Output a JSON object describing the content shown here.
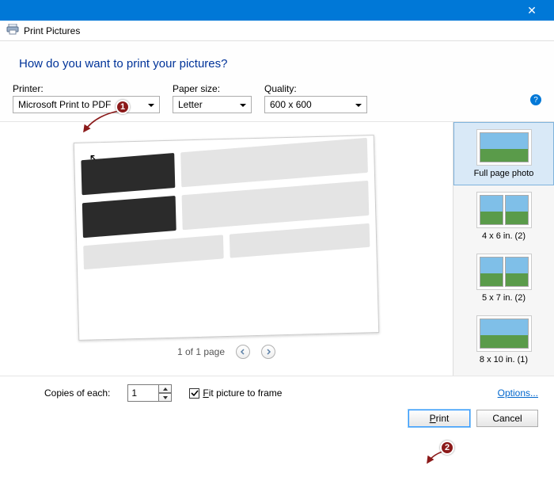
{
  "titlebar": {
    "close": "✕"
  },
  "subtitle": {
    "text": "Print Pictures"
  },
  "heading": {
    "question": "How do you want to print your pictures?"
  },
  "controls": {
    "printer": {
      "label": "Printer:",
      "value": "Microsoft Print to PDF",
      "width": 186
    },
    "paper": {
      "label": "Paper size:",
      "value": "Letter",
      "width": 100
    },
    "quality": {
      "label": "Quality:",
      "value": "600 x 600",
      "width": 130
    },
    "help": "?"
  },
  "preview": {
    "page_status": "1 of 1 page"
  },
  "layouts": [
    {
      "label": "Full page photo",
      "count": 1,
      "selected": true
    },
    {
      "label": "4 x 6 in. (2)",
      "count": 2,
      "selected": false
    },
    {
      "label": "5 x 7 in. (2)",
      "count": 2,
      "selected": false
    },
    {
      "label": "8 x 10 in. (1)",
      "count": 1,
      "selected": false
    }
  ],
  "bottom": {
    "copies_label": "Copies of each:",
    "copies_value": "1",
    "fit_label": "Fit picture to frame",
    "fit_checked": true,
    "options_link": "Options..."
  },
  "buttons": {
    "print": "Print",
    "cancel": "Cancel"
  },
  "annotations": {
    "one": "1",
    "two": "2"
  }
}
